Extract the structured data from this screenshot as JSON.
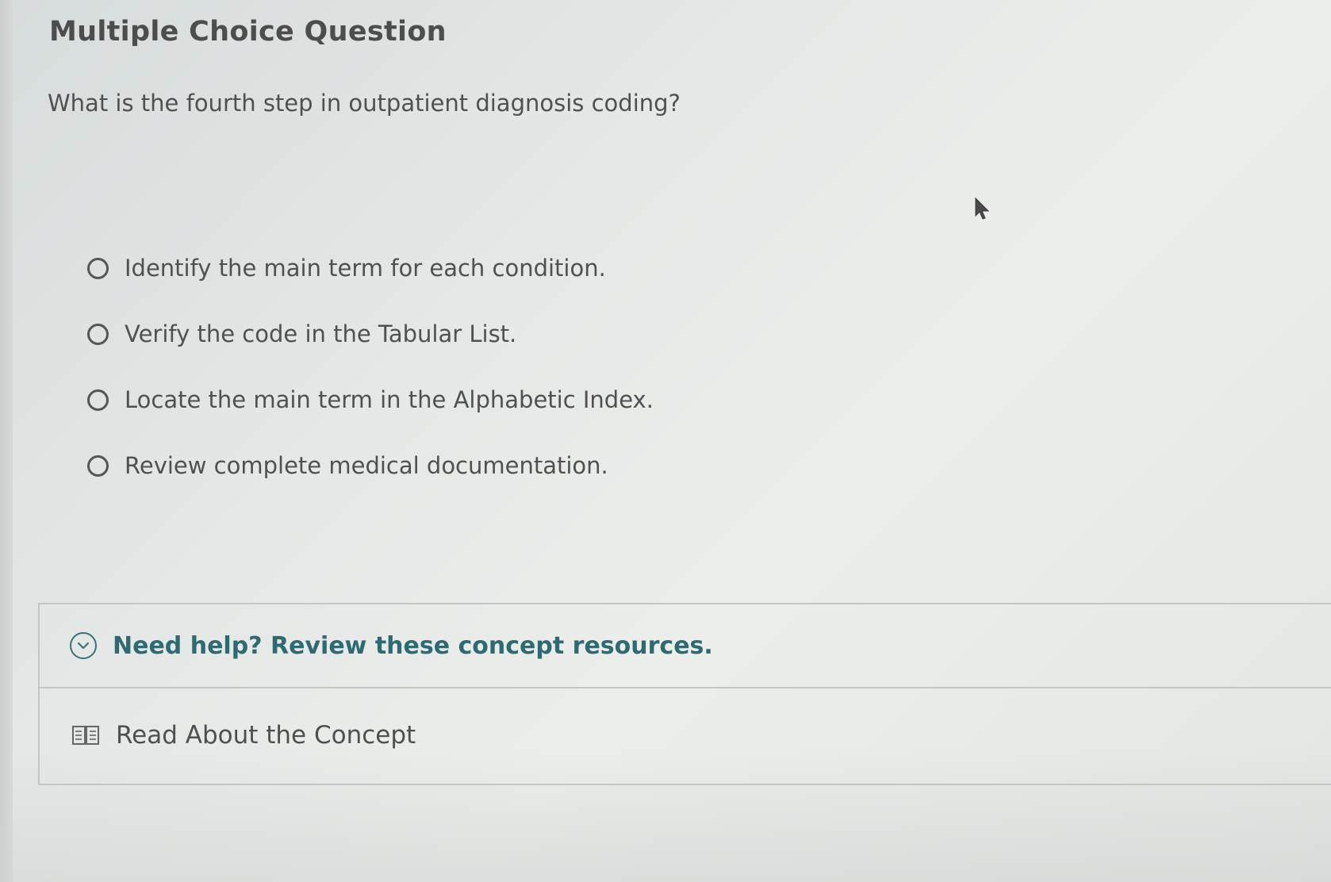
{
  "question_header": {
    "title": "Multiple Choice Question"
  },
  "question": {
    "text": "What is the fourth step in outpatient diagnosis coding?"
  },
  "options": [
    {
      "label": "Identify the main term for each condition.",
      "selected": false
    },
    {
      "label": "Verify the code in the Tabular List.",
      "selected": false
    },
    {
      "label": "Locate the main term in the Alphabetic Index.",
      "selected": false
    },
    {
      "label": "Review complete medical documentation.",
      "selected": false
    }
  ],
  "help": {
    "toggle_label": "Need help? Review these concept resources.",
    "resources": [
      {
        "label": "Read About the Concept",
        "icon": "book-icon"
      }
    ]
  },
  "colors": {
    "accent": "#2f6a72",
    "text": "#505050",
    "border": "#c2c7c6"
  }
}
